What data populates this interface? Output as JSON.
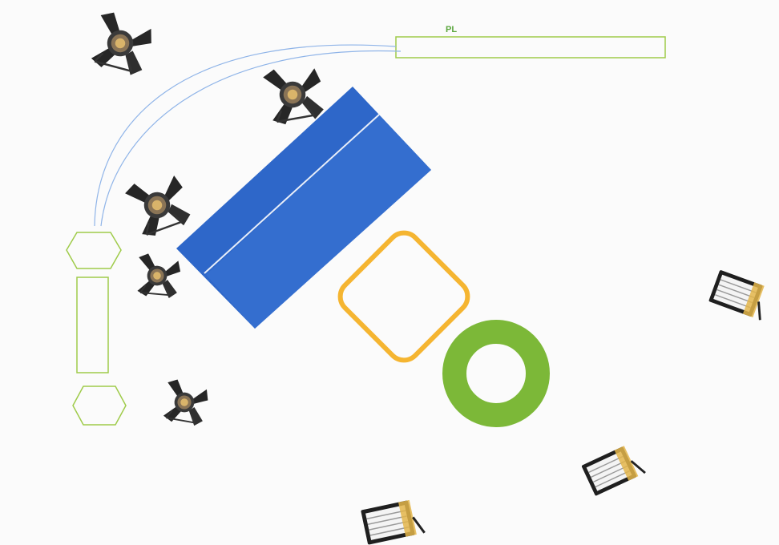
{
  "colors": {
    "background": "#fbfbfb",
    "outline_green": "#9fcb4a",
    "cable_blue": "#8fb4e8",
    "stage_blue": "#2e67c9",
    "stage_blue_dark": "#1f52b3",
    "square_orange": "#f5b531",
    "ring_green": "#7cb838",
    "pl_text": "#5aa63c",
    "fixture_dark": "#262626",
    "fixture_metal": "#8a7456",
    "softbox_white": "#f4f4f4",
    "softbox_gold": "#e3b54a"
  },
  "plan": {
    "pl_label": "PL"
  },
  "icons": {
    "spotlight": "fresnel-spotlight-icon",
    "softbox": "led-softbox-panel-icon"
  }
}
